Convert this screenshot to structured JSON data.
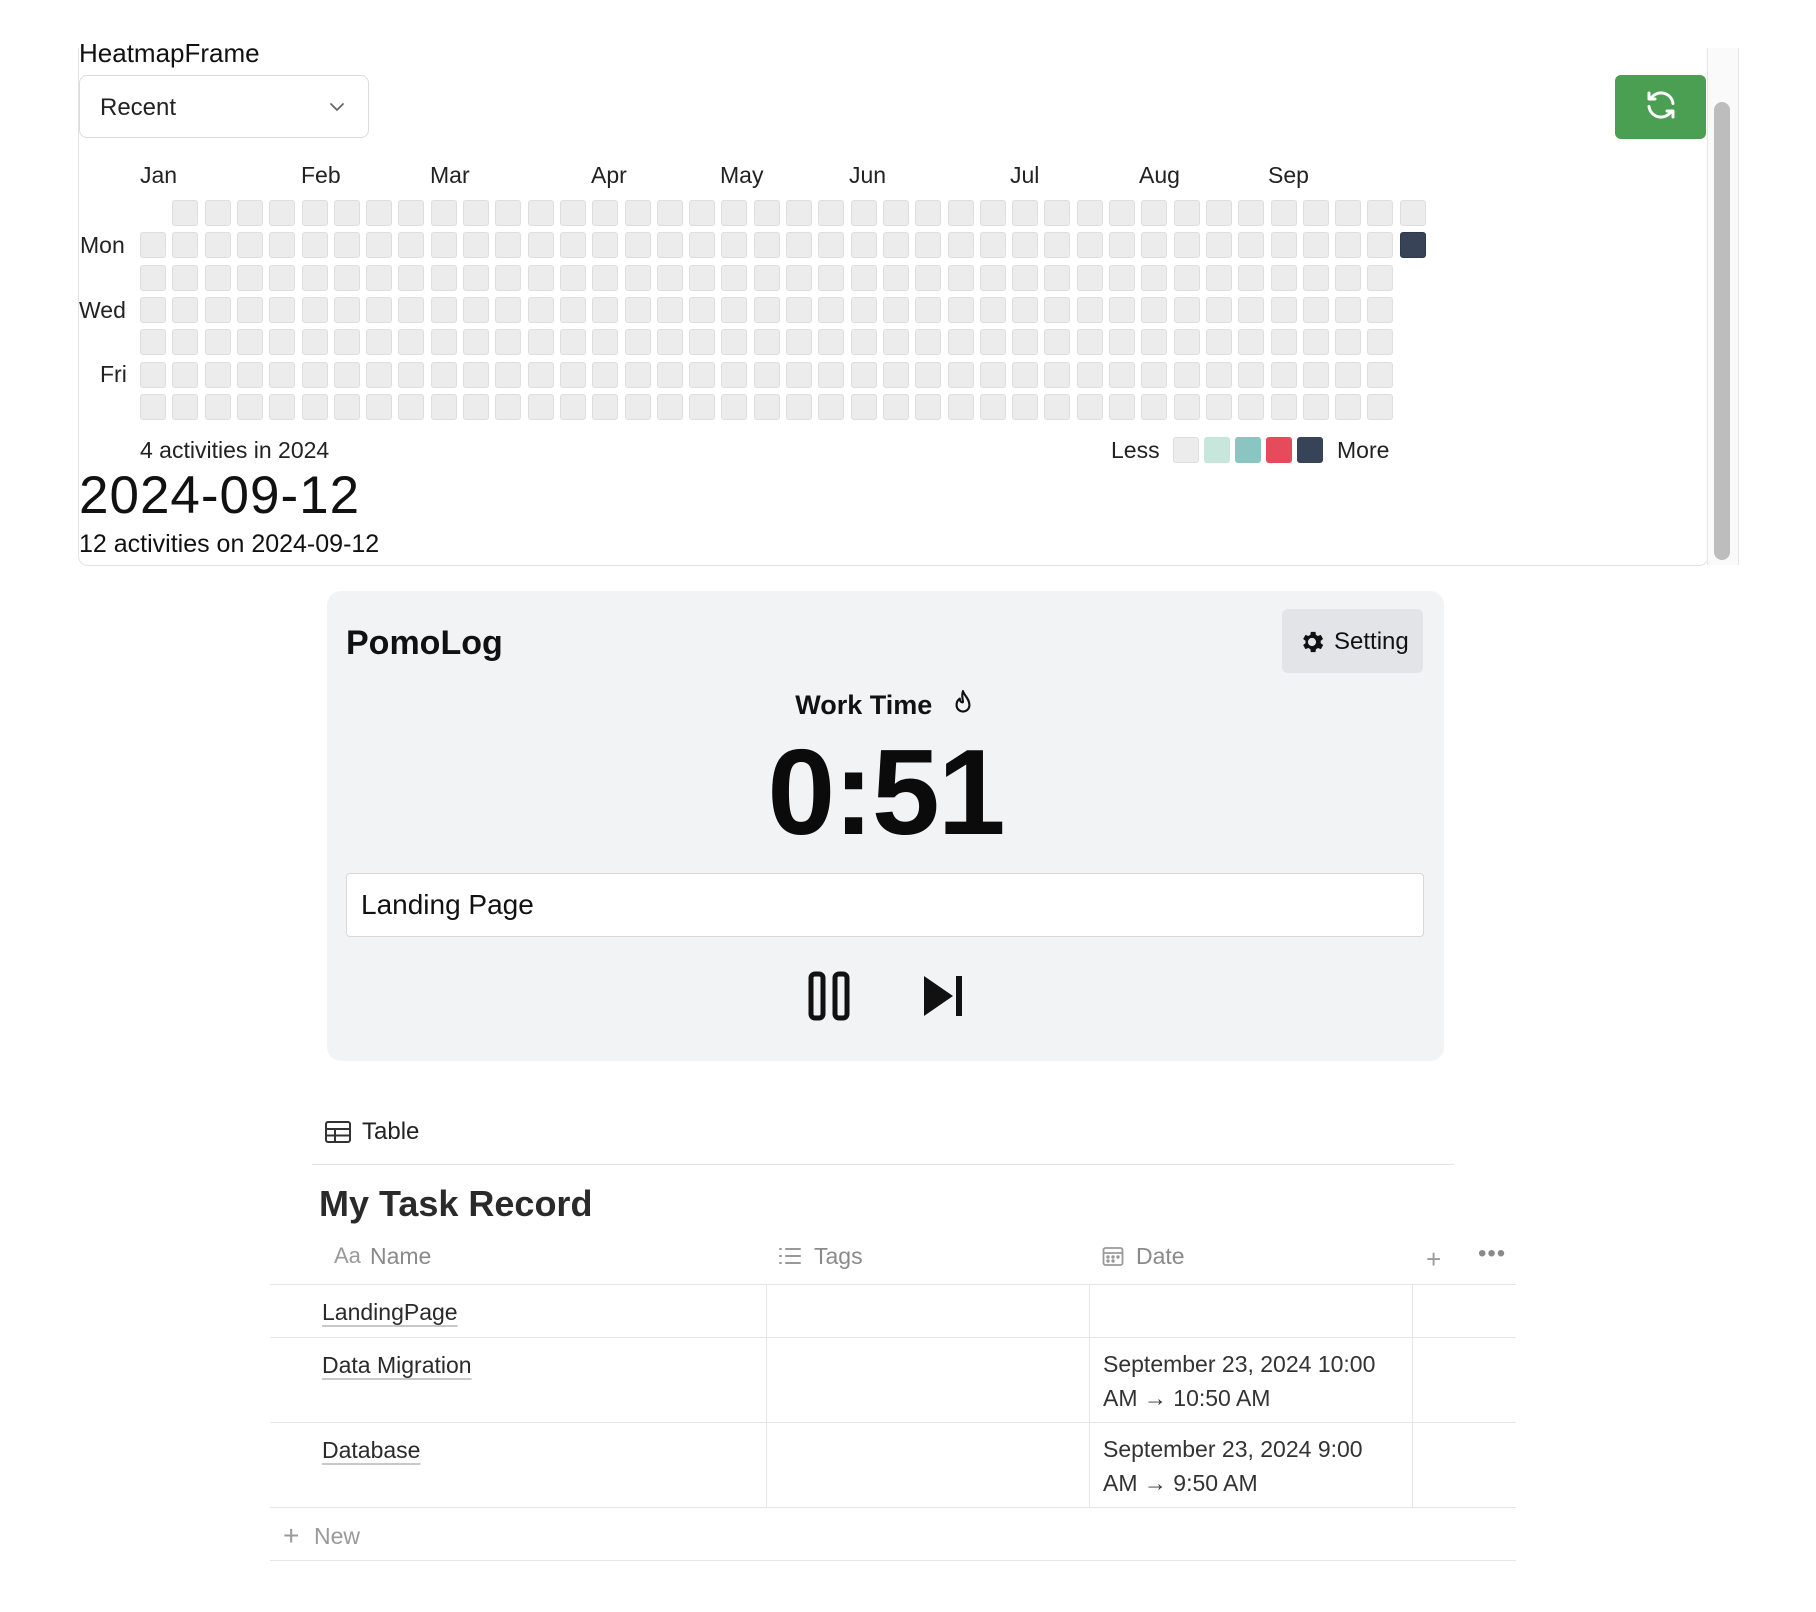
{
  "heatmap": {
    "frame_title": "HeatmapFrame",
    "range_select": "Recent",
    "months": [
      "Jan",
      "Feb",
      "Mar",
      "Apr",
      "May",
      "Jun",
      "Jul",
      "Aug",
      "Sep"
    ],
    "weekdays": [
      "Mon",
      "Wed",
      "Fri"
    ],
    "active_cell": {
      "week": 39,
      "day": "Mon"
    },
    "summary": "4 activities in 2024",
    "legend": {
      "less": "Less",
      "more": "More",
      "colors": [
        "#ececec",
        "#c7e6dc",
        "#8bc5c2",
        "#e54b5b",
        "#374357"
      ]
    },
    "selected_date": "2024-09-12",
    "selected_count_text": "12 activities on 2024-09-12",
    "accent_color": "#4a9f52"
  },
  "pomolog": {
    "title": "PomoLog",
    "setting_label": "Setting",
    "mode_label": "Work Time",
    "timer": "0:51",
    "task_value": "Landing Page"
  },
  "table": {
    "view_tab_label": "Table",
    "title": "My Task Record",
    "columns": {
      "name": "Name",
      "tags": "Tags",
      "date": "Date"
    },
    "rows": [
      {
        "name": "LandingPage",
        "tags": "",
        "date": ""
      },
      {
        "name": "Data Migration",
        "tags": "",
        "date": "September 23, 2024 10:00 AM → 10:50 AM"
      },
      {
        "name": "Database",
        "tags": "",
        "date": "September 23, 2024 9:00 AM → 9:50 AM"
      }
    ],
    "new_label": "New"
  }
}
